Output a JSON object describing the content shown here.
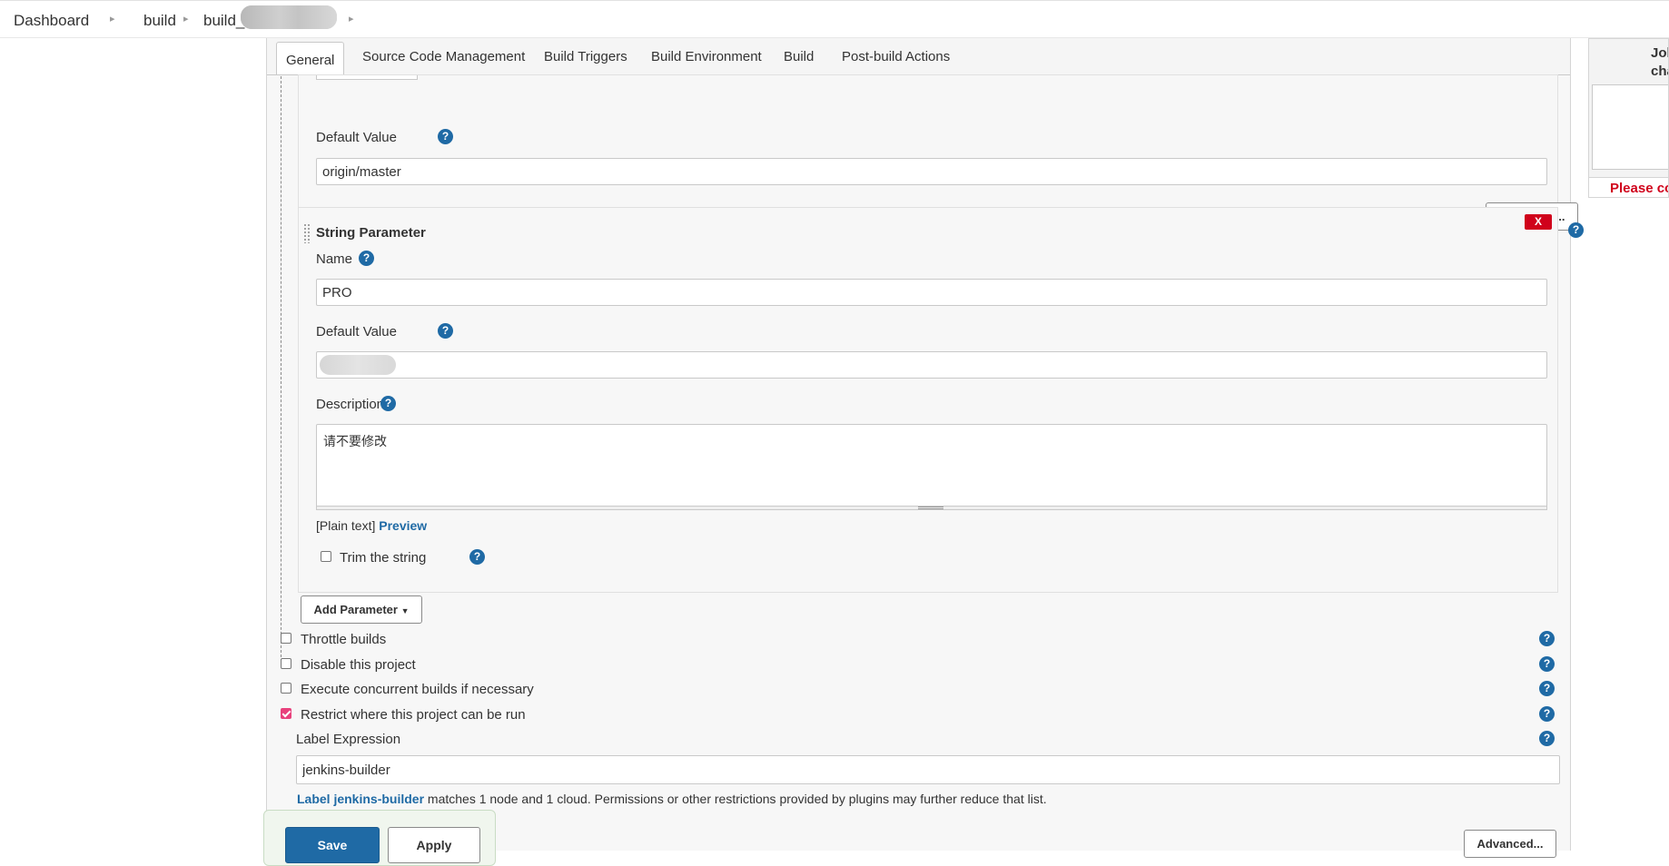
{
  "breadcrumb": {
    "items": [
      "Dashboard",
      "build",
      "build_"
    ]
  },
  "tabs": [
    "General",
    "Source Code Management",
    "Build Triggers",
    "Build Environment",
    "Build",
    "Post-build Actions"
  ],
  "first_param": {
    "default_value_label": "Default Value",
    "default_value": "origin/master",
    "advanced_label": "Advanced..."
  },
  "string_param": {
    "title": "String Parameter",
    "delete_label": "X",
    "name_label": "Name",
    "name_value": "PRO",
    "default_value_label": "Default Value",
    "description_label": "Description",
    "description_value": "请不要修改",
    "plain_text": "[Plain text]",
    "preview_label": "Preview",
    "trim_label": "Trim the string"
  },
  "add_parameter_label": "Add Parameter",
  "options": [
    {
      "label": "Throttle builds",
      "checked": false
    },
    {
      "label": "Disable this project",
      "checked": false
    },
    {
      "label": "Execute concurrent builds if necessary",
      "checked": false
    },
    {
      "label": "Restrict where this project can be run",
      "checked": true
    }
  ],
  "label_expression": {
    "label": "Label Expression",
    "value": "jenkins-builder",
    "link_text": "Label jenkins-builder",
    "info_text": " matches 1 node and 1 cloud. Permissions or other restrictions provided by plugins may further reduce that list.",
    "advanced_label": "Advanced..."
  },
  "footer": {
    "save_label": "Save",
    "apply_label": "Apply"
  },
  "right_panel": {
    "title_line1": "Jol",
    "title_line2": "cha",
    "warning": "Please co"
  },
  "colors": {
    "accent": "#1f6aa5",
    "danger": "#d0021b",
    "checked": "#e8417c"
  }
}
